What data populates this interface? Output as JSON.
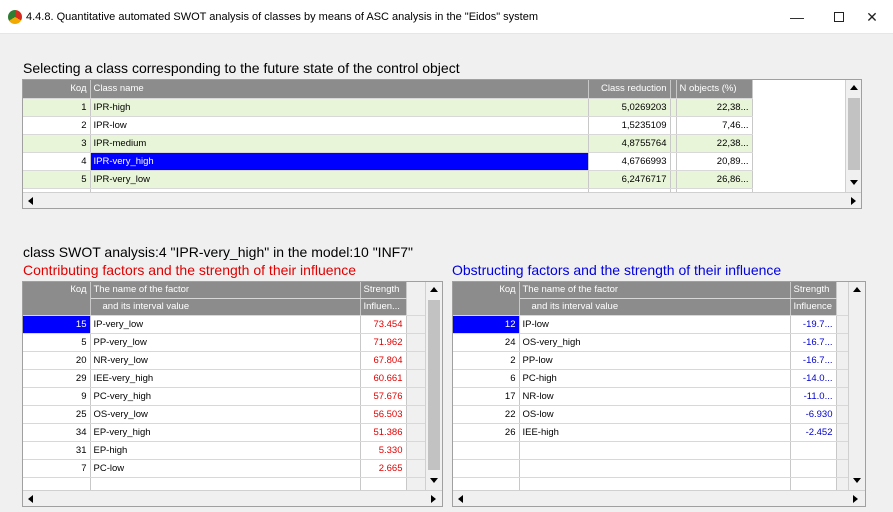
{
  "window": {
    "title": "4.4.8. Quantitative automated SWOT analysis of classes by means of ASC analysis in the \"Eidos\" system",
    "minimize": "—",
    "close": "✕"
  },
  "classes": {
    "heading": "Selecting a class corresponding to the future state of the control object",
    "columns": {
      "code": "Код",
      "name": "Class name",
      "reduction": "Class reduction",
      "nobjects": "N objects (%)"
    },
    "rows": [
      {
        "code": "1",
        "name": "IPR-high",
        "reduction": "5,0269203",
        "nobjects": "22,38..."
      },
      {
        "code": "2",
        "name": "IPR-low",
        "reduction": "1,5235109",
        "nobjects": "7,46..."
      },
      {
        "code": "3",
        "name": "IPR-medium",
        "reduction": "4,8755764",
        "nobjects": "22,38..."
      },
      {
        "code": "4",
        "name": "IPR-very_high",
        "reduction": "4,6766993",
        "nobjects": "20,89..."
      },
      {
        "code": "5",
        "name": "IPR-very_low",
        "reduction": "6,2476717",
        "nobjects": "26,86..."
      }
    ],
    "selected_code": "4"
  },
  "swot": {
    "heading": "class SWOT analysis:4 \"IPR-very_high\" in the model:10 \"INF7\"",
    "contributing": {
      "heading": "Contributing factors and the strength of their influence",
      "columns": {
        "code": "Код",
        "name1": "The name of the factor",
        "name2": "and its interval value",
        "strength1": "Strength",
        "strength2": "Influen..."
      },
      "rows": [
        {
          "code": "15",
          "name": "IP-very_low",
          "value": "73.454"
        },
        {
          "code": "5",
          "name": "PP-very_low",
          "value": "71.962"
        },
        {
          "code": "20",
          "name": "NR-very_low",
          "value": "67.804"
        },
        {
          "code": "29",
          "name": "IEE-very_high",
          "value": "60.661"
        },
        {
          "code": "9",
          "name": "PC-very_high",
          "value": "57.676"
        },
        {
          "code": "25",
          "name": "OS-very_low",
          "value": "56.503"
        },
        {
          "code": "34",
          "name": "EP-very_high",
          "value": "51.386"
        },
        {
          "code": "31",
          "name": "EP-high",
          "value": "5.330"
        },
        {
          "code": "7",
          "name": "PC-low",
          "value": "2.665"
        }
      ]
    },
    "obstructing": {
      "heading": "Obstructing factors and the strength of their influence",
      "columns": {
        "code": "Код",
        "name1": "The name of the factor",
        "name2": "and its interval value",
        "strength1": "Strength",
        "strength2": "Influence"
      },
      "rows": [
        {
          "code": "12",
          "name": "IP-low",
          "value": "-19.7..."
        },
        {
          "code": "24",
          "name": "OS-very_high",
          "value": "-16.7..."
        },
        {
          "code": "2",
          "name": "PP-low",
          "value": "-16.7..."
        },
        {
          "code": "6",
          "name": "PC-high",
          "value": "-14.0..."
        },
        {
          "code": "17",
          "name": "NR-low",
          "value": "-11.0..."
        },
        {
          "code": "22",
          "name": "OS-low",
          "value": "-6.930"
        },
        {
          "code": "26",
          "name": "IEE-high",
          "value": "-2.452"
        }
      ]
    }
  },
  "colors": {
    "selection": "#0000ff",
    "row_green": "#e8f5d8",
    "header": "#8c8c8c",
    "positive": "#e00000",
    "negative": "#0000d0"
  }
}
